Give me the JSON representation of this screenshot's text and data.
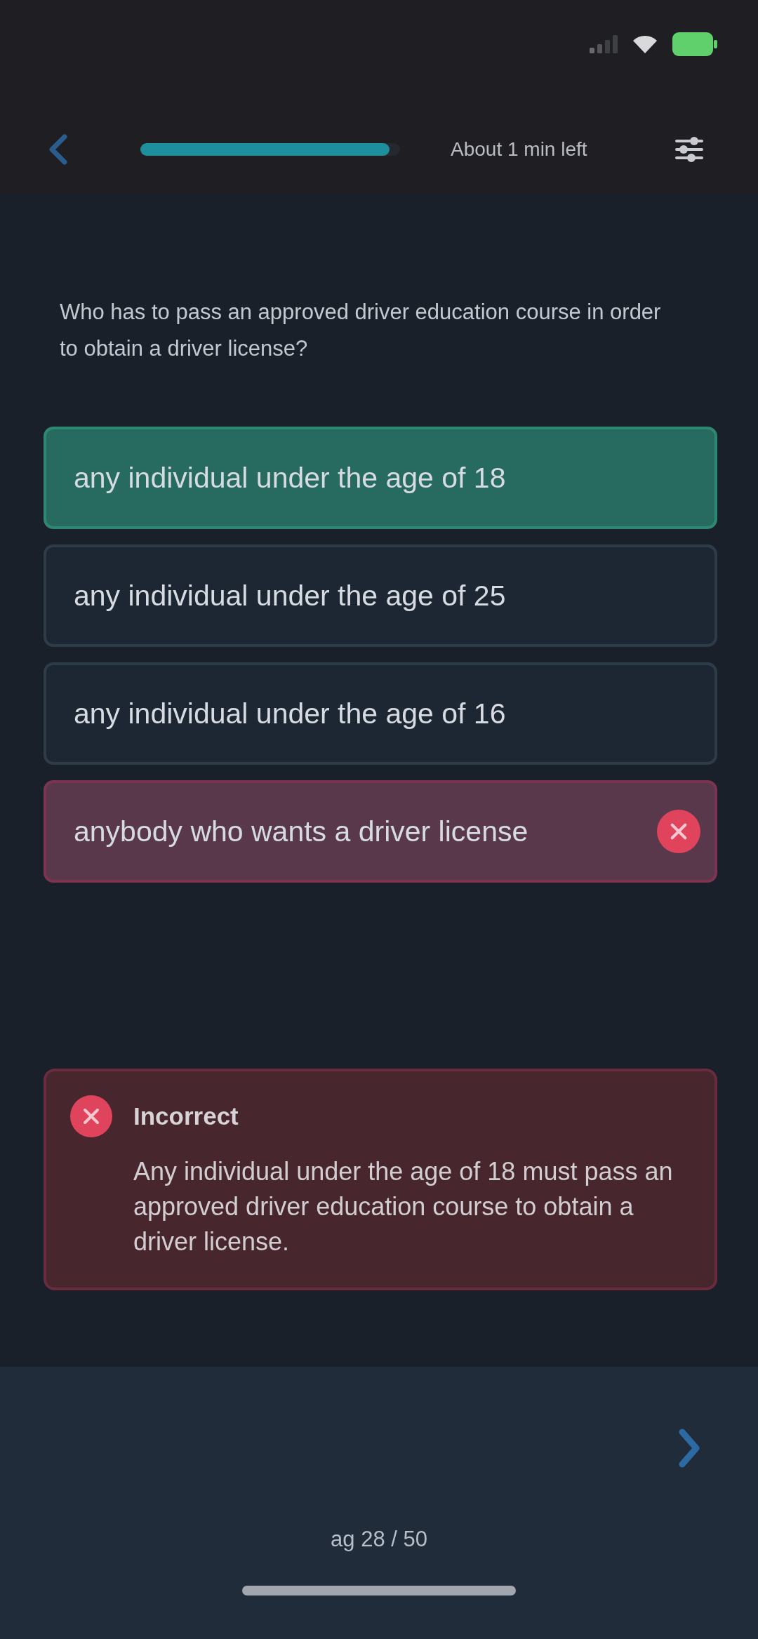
{
  "header": {
    "time_left": "About 1 min left",
    "progress": {
      "level": 0.96
    }
  },
  "question": "Who has to pass an approved driver education course in order to obtain a driver license?",
  "options": [
    {
      "text": "any individual under the age of 18",
      "correct": true,
      "selected": false
    },
    {
      "text": "any individual under the age of 25",
      "correct": false,
      "selected": false
    },
    {
      "text": "any individual under the age of 16",
      "correct": false,
      "selected": false
    },
    {
      "text": "anybody who wants a driver license",
      "correct": false,
      "selected": true
    }
  ],
  "feedback": {
    "kind": "incorrect",
    "title": "Incorrect",
    "text": "Any individual under the age of 18 must pass an approved driver education course to obtain a driver license."
  },
  "footer": {
    "counter": "ag 28 / 50"
  }
}
